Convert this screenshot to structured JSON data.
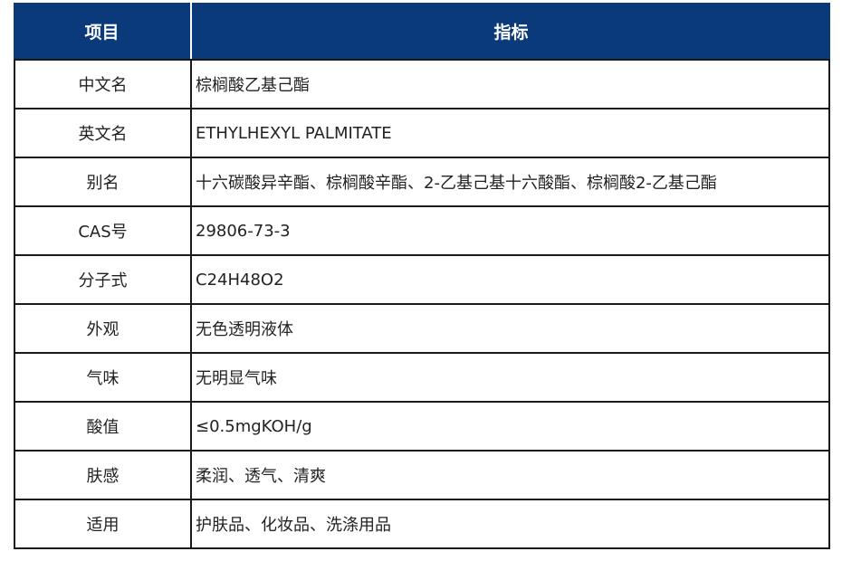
{
  "table": {
    "header": {
      "item": "项目",
      "value": "指标"
    },
    "colors": {
      "header_background": "#0a3a7a",
      "header_text": "#ffffff"
    },
    "rows": [
      {
        "item": "中文名",
        "value": "棕榈酸乙基己酯"
      },
      {
        "item": "英文名",
        "value": "ETHYLHEXYL PALMITATE"
      },
      {
        "item": "别名",
        "value": "十六碳酸异辛酯、棕榈酸辛酯、2-乙基己基十六酸酯、棕榈酸2-乙基己酯"
      },
      {
        "item": "CAS号",
        "value": "29806-73-3"
      },
      {
        "item": "分子式",
        "value": "C24H48O2"
      },
      {
        "item": "外观",
        "value": "无色透明液体"
      },
      {
        "item": "气味",
        "value": "无明显气味"
      },
      {
        "item": "酸值",
        "value": "≤0.5mgKOH/g"
      },
      {
        "item": "肤感",
        "value": "柔润、透气、清爽"
      },
      {
        "item": "适用",
        "value": "护肤品、化妆品、洗涤用品"
      }
    ]
  }
}
